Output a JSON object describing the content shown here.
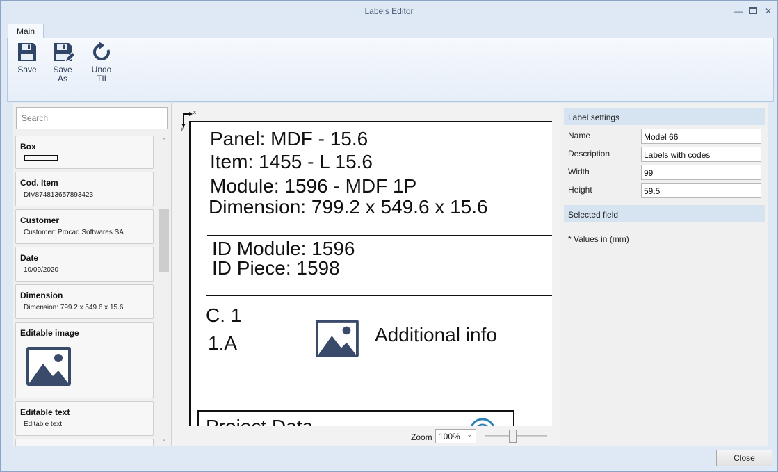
{
  "window": {
    "title": "Labels Editor"
  },
  "ribbon": {
    "tab_main": "Main",
    "save": "Save",
    "save_as_line1": "Save",
    "save_as_line2": "As",
    "undo_line1": "Undo",
    "undo_line2": "TII"
  },
  "search": {
    "placeholder": "Search"
  },
  "fields": [
    {
      "title": "Box",
      "value": ""
    },
    {
      "title": "Cod. Item",
      "value": "DIV874813657893423"
    },
    {
      "title": "Customer",
      "value": "Customer: Procad Softwares SA"
    },
    {
      "title": "Date",
      "value": "10/09/2020"
    },
    {
      "title": "Dimension",
      "value": "Dimension: 799.2 x 549.6 x 15.6"
    },
    {
      "title": "Editable image",
      "value": ""
    },
    {
      "title": "Editable text",
      "value": "Editable text"
    }
  ],
  "canvas": {
    "axis_x": "x",
    "axis_y": "y",
    "line1": "Panel: MDF - 15.6",
    "line2": "Item: 1455 - L 15.6",
    "line3": "Module: 1596 - MDF 1P",
    "line4": "Dimension: 799.2 x 549.6 x 15.6",
    "line5": "ID Module: 1596",
    "line6": "ID Piece: 1598",
    "line7": "C. 1",
    "line8": "1.A",
    "additional": "Additional info",
    "project": "Project Data"
  },
  "zoom": {
    "label": "Zoom",
    "value": "100%"
  },
  "label_settings": {
    "header": "Label settings",
    "name_label": "Name",
    "name_value": "Model 66",
    "description_label": "Description",
    "description_value": "Labels with codes",
    "width_label": "Width",
    "width_value": "99",
    "height_label": "Height",
    "height_value": "59.5"
  },
  "selected_field": {
    "header": "Selected field",
    "note": "* Values in (mm)"
  },
  "footer": {
    "close": "Close"
  },
  "colors": {
    "icon_blue": "#3a4a6b",
    "ribbon_icon": "#2f4668",
    "section_bg": "#d6e3f1"
  }
}
